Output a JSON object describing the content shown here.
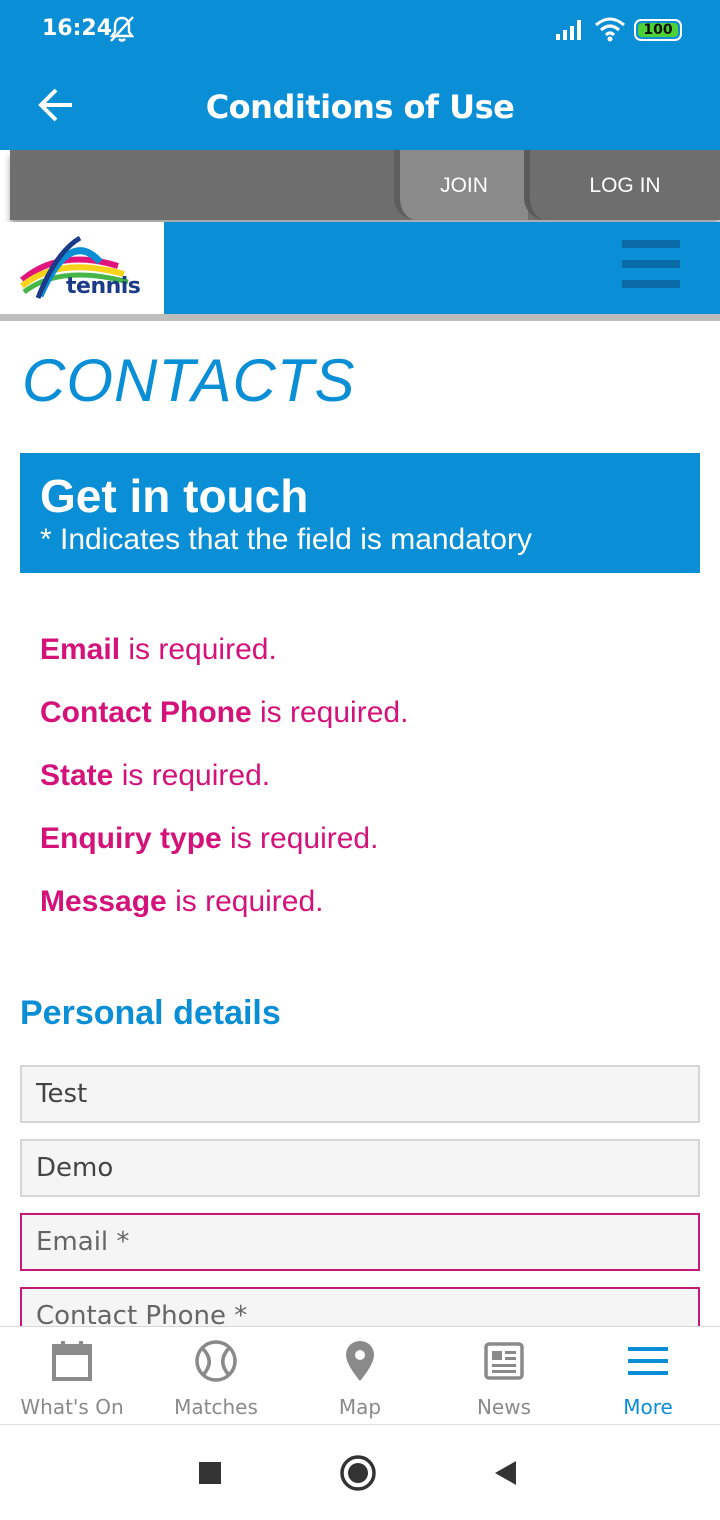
{
  "status_bar": {
    "time": "16:24",
    "battery": "100",
    "mute_icon": "notifications-off-icon",
    "signal_icon": "cell-signal-icon",
    "wifi_icon": "wifi-icon"
  },
  "app_bar": {
    "title": "Conditions of Use",
    "back_icon": "arrow-left-icon"
  },
  "auth": {
    "join_label": "JOIN",
    "login_label": "LOG IN"
  },
  "site_header": {
    "logo_text": "tennis",
    "menu_icon": "hamburger-icon"
  },
  "page": {
    "heading": "CONTACTS",
    "get_in_touch": {
      "title": "Get in touch",
      "subtitle": "* Indicates that the field is mandatory"
    },
    "errors": [
      {
        "field": "Email",
        "suffix": " is required."
      },
      {
        "field": "Contact Phone",
        "suffix": " is required."
      },
      {
        "field": "State",
        "suffix": " is required."
      },
      {
        "field": "Enquiry type",
        "suffix": " is required."
      },
      {
        "field": "Message",
        "suffix": " is required."
      }
    ],
    "section_title": "Personal details",
    "fields": {
      "first_name_value": "Test",
      "last_name_value": "Demo",
      "email_placeholder": "Email *",
      "phone_placeholder": "Contact Phone *"
    }
  },
  "bottom_nav": [
    {
      "label": "What's On",
      "icon": "calendar-icon"
    },
    {
      "label": "Matches",
      "icon": "tennis-ball-icon"
    },
    {
      "label": "Map",
      "icon": "map-pin-icon"
    },
    {
      "label": "News",
      "icon": "newspaper-icon"
    },
    {
      "label": "More",
      "icon": "menu-icon"
    }
  ],
  "colors": {
    "brand_blue": "#0a8fd6",
    "error_pink": "#d4127a",
    "nav_inactive": "#8a8a8a"
  }
}
